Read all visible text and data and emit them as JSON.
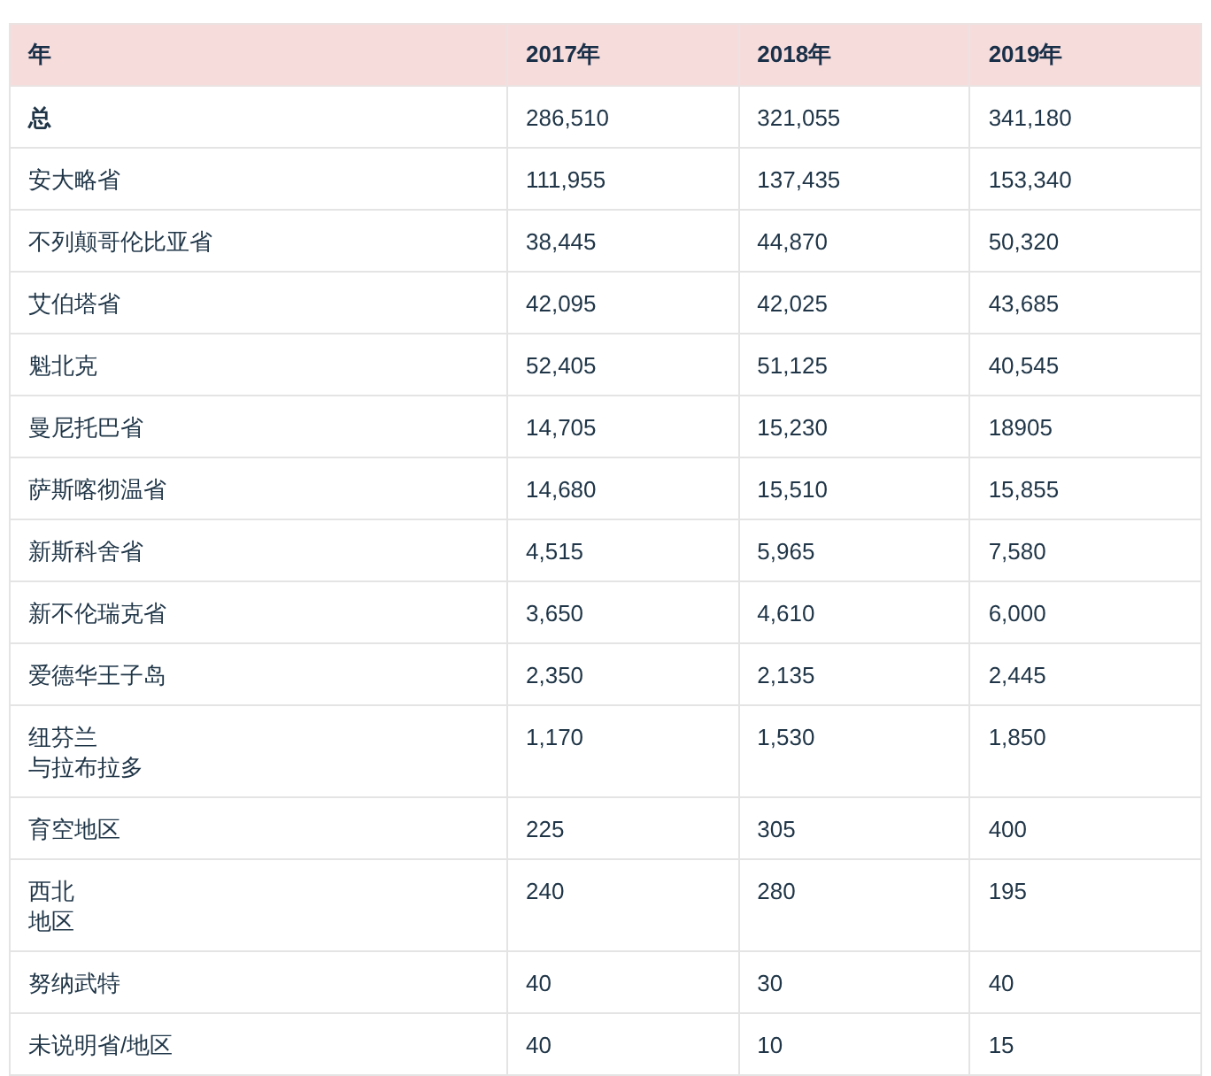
{
  "table": {
    "columns": [
      "年",
      "2017年",
      "2018年",
      "2019年"
    ],
    "rows": [
      {
        "kind": "total",
        "cells": [
          "总",
          "286,510",
          "321,055",
          "341,180"
        ]
      },
      {
        "kind": "region",
        "cells": [
          "安大略省",
          "111,955",
          "137,435",
          "153,340"
        ]
      },
      {
        "kind": "region",
        "cells": [
          "不列颠哥伦比亚省",
          "38,445",
          "44,870",
          "50,320"
        ]
      },
      {
        "kind": "region",
        "cells": [
          "艾伯塔省",
          "42,095",
          "42,025",
          "43,685"
        ]
      },
      {
        "kind": "region",
        "cells": [
          "魁北克",
          "52,405",
          "51,125",
          "40,545"
        ]
      },
      {
        "kind": "region",
        "cells": [
          "曼尼托巴省",
          "14,705",
          "15,230",
          "18905"
        ]
      },
      {
        "kind": "region",
        "cells": [
          "萨斯喀彻温省",
          "14,680",
          "15,510",
          "15,855"
        ]
      },
      {
        "kind": "region",
        "cells": [
          "新斯科舍省",
          "4,515",
          "5,965",
          "7,580"
        ]
      },
      {
        "kind": "region",
        "cells": [
          "新不伦瑞克省",
          "3,650",
          "4,610",
          "6,000"
        ]
      },
      {
        "kind": "region",
        "cells": [
          "爱德华王子岛",
          "2,350",
          "2,135",
          "2,445"
        ]
      },
      {
        "kind": "region",
        "cells": [
          [
            "纽芬兰",
            "与拉布拉多"
          ],
          "1,170",
          "1,530",
          "1,850"
        ]
      },
      {
        "kind": "region",
        "cells": [
          "育空地区",
          "225",
          "305",
          "400"
        ]
      },
      {
        "kind": "region",
        "cells": [
          [
            "西北",
            "地区"
          ],
          "240",
          "280",
          "195"
        ]
      },
      {
        "kind": "region",
        "cells": [
          "努纳武特",
          "40",
          "30",
          "40"
        ]
      },
      {
        "kind": "region",
        "cells": [
          "未说明省/地区",
          "40",
          "10",
          "15"
        ]
      }
    ]
  }
}
